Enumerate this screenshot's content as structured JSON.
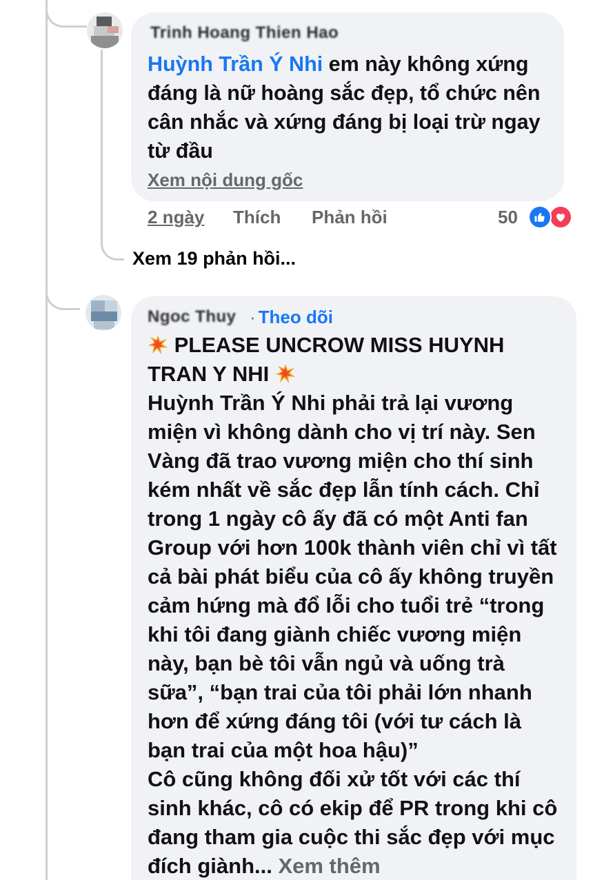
{
  "comment1": {
    "author": "Trinh Hoang Thien Hao",
    "mention": "Huỳnh Trần Ý Nhi",
    "text": " em này không xứng đáng là nữ hoàng sắc đẹp, tổ chức nên cân nhắc và xứng đáng bị loại trừ ngay từ đầu",
    "see_original": "Xem nội dung gốc",
    "time": "2 ngày",
    "like_label": "Thích",
    "reply_label": "Phản hồi",
    "reaction_count": "50",
    "reactions": [
      "like-icon",
      "love-icon"
    ],
    "view_replies": "Xem 19 phản hồi..."
  },
  "comment2": {
    "author": "Ngoc Thuy",
    "separator": "·",
    "follow_label": "Theo dõi",
    "emoji": "collision-emoji",
    "headline": " PLEASE UNCROW MISS HUYNH TRAN Y NHI ",
    "paragraph1": "Huỳnh Trần Ý Nhi phải trả lại vương miện vì không dành cho vị trí này. Sen Vàng đã trao vương miện cho thí sinh kém nhất về sắc đẹp lẫn tính cách. Chỉ trong 1 ngày cô ấy đã có một Anti fan Group với hơn 100k thành viên chỉ vì tất cả bài phát biểu của cô ấy không truyền cảm hứng mà đổ lỗi cho tuổi trẻ “trong khi tôi đang giành chiếc vương miện này, bạn bè tôi vẫn ngủ và uống trà sữa”, “bạn trai của tôi phải lớn nhanh hơn để xứng đáng tôi (với tư cách là bạn trai của một hoa hậu)”",
    "paragraph2": "Cô cũng không đối xử tốt với các thí sinh khác, cô có ekip để PR trong khi cô đang tham gia cuộc thi sắc đẹp với mục đích giành...",
    "see_more": " Xem thêm"
  },
  "colors": {
    "link_blue": "#1877f2",
    "bubble_bg": "#f0f2f5",
    "meta_gray": "#65676b",
    "love_red": "#f33e58"
  }
}
